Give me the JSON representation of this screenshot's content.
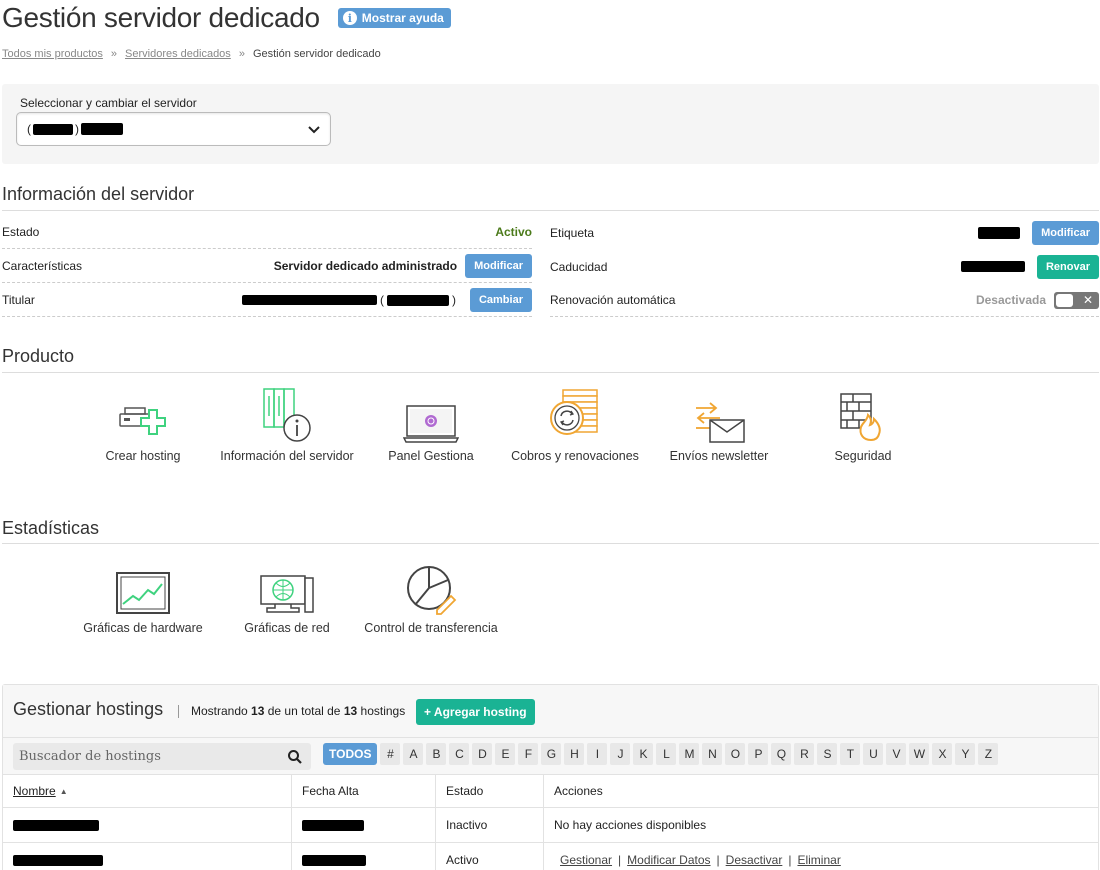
{
  "header": {
    "title": "Gestión servidor dedicado",
    "help_label": "Mostrar ayuda",
    "help_icon": "info-icon"
  },
  "breadcrumb": {
    "items": [
      "Todos mis productos",
      "Servidores dedicados",
      "Gestión servidor dedicado"
    ],
    "separator": "»"
  },
  "server_selector": {
    "label": "Seleccionar y cambiar el servidor"
  },
  "server_info": {
    "title": "Información del servidor",
    "estado": {
      "label": "Estado",
      "value": "Activo"
    },
    "caracteristicas": {
      "label": "Características",
      "value": "Servidor dedicado administrado",
      "button": "Modificar"
    },
    "titular": {
      "label": "Titular",
      "button": "Cambiar"
    },
    "etiqueta": {
      "label": "Etiqueta",
      "button": "Modificar"
    },
    "caducidad": {
      "label": "Caducidad",
      "button": "Renovar"
    },
    "renovacion": {
      "label": "Renovación automática",
      "value": "Desactivada",
      "toggle_symbol": "✕"
    }
  },
  "producto": {
    "title": "Producto",
    "tiles": [
      {
        "label": "Crear hosting",
        "icon": "server-add-icon"
      },
      {
        "label": "Información del servidor",
        "icon": "server-info-icon"
      },
      {
        "label": "Panel Gestiona",
        "icon": "monitor-panel-icon"
      },
      {
        "label": "Cobros y renovaciones",
        "icon": "coins-renew-icon"
      },
      {
        "label": "Envíos newsletter",
        "icon": "envelope-send-icon"
      },
      {
        "label": "Seguridad",
        "icon": "firewall-icon"
      }
    ]
  },
  "estadisticas": {
    "title": "Estadísticas",
    "tiles": [
      {
        "label": "Gráficas de hardware",
        "icon": "line-chart-icon"
      },
      {
        "label": "Gráficas de red",
        "icon": "network-chart-icon"
      },
      {
        "label": "Control de transferencia",
        "icon": "pie-chart-icon"
      }
    ]
  },
  "hostings": {
    "title": "Gestionar hostings",
    "count_prefix": "Mostrando",
    "count_shown": "13",
    "count_middle": "de un total de",
    "count_total": "13",
    "count_suffix": "hostings",
    "add_button": "+ Agregar hosting",
    "search_placeholder": "Buscador de hostings",
    "letters": [
      "TODOS",
      "#",
      "A",
      "B",
      "C",
      "D",
      "E",
      "F",
      "G",
      "H",
      "I",
      "J",
      "K",
      "L",
      "M",
      "N",
      "O",
      "P",
      "Q",
      "R",
      "S",
      "T",
      "U",
      "V",
      "W",
      "X",
      "Y",
      "Z"
    ],
    "columns": [
      "Nombre",
      "Fecha Alta",
      "Estado",
      "Acciones"
    ],
    "rows": [
      {
        "estado": "Inactivo",
        "acciones_text": "No hay acciones disponibles"
      },
      {
        "estado": "Activo",
        "actions": [
          "Gestionar",
          "Modificar Datos",
          "Desactivar",
          "Eliminar"
        ]
      }
    ]
  },
  "colors": {
    "primary_blue": "#5b9bd5",
    "green": "#1ab394",
    "active_text": "#4b7a1a"
  }
}
